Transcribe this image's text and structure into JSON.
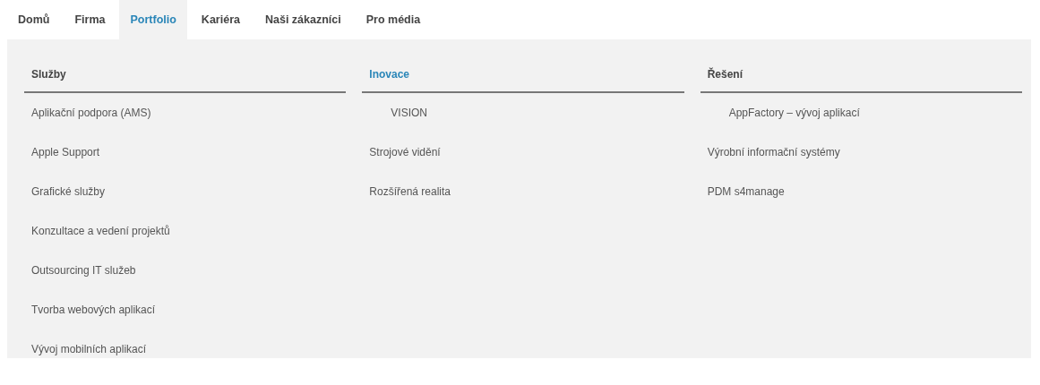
{
  "tabs": [
    {
      "label": "Domů",
      "selected": false
    },
    {
      "label": "Firma",
      "selected": false
    },
    {
      "label": "Portfolio",
      "selected": true
    },
    {
      "label": "Kariéra",
      "selected": false
    },
    {
      "label": "Naši zákazníci",
      "selected": false
    },
    {
      "label": "Pro média",
      "selected": false
    }
  ],
  "columns": [
    {
      "heading": "Služby",
      "active": false,
      "items": [
        {
          "label": "Aplikační podpora (AMS)",
          "kind": "plain"
        },
        {
          "label": "Apple Support",
          "kind": "plain"
        },
        {
          "label": "Grafické služby",
          "kind": "plain"
        },
        {
          "label": "Konzultace a vedení projektů",
          "kind": "plain"
        },
        {
          "label": "Outsourcing IT služeb",
          "kind": "plain"
        },
        {
          "label": "Tvorba webových aplikací",
          "kind": "plain"
        },
        {
          "label": "Vývoj mobilních aplikací",
          "kind": "plain"
        }
      ]
    },
    {
      "heading": "Inovace",
      "active": true,
      "items": [
        {
          "label": "VISION",
          "kind": "indented"
        },
        {
          "label": "Strojové vidění",
          "kind": "plain"
        },
        {
          "label": "Rozšířená realita",
          "kind": "plain"
        }
      ]
    },
    {
      "heading": "Řešení",
      "active": false,
      "items": [
        {
          "label": "AppFactory – vývoj aplikací",
          "kind": "indented"
        },
        {
          "label": "Výrobní informační systémy",
          "kind": "plain"
        },
        {
          "label": "PDM s4manage",
          "kind": "plain"
        }
      ]
    }
  ]
}
